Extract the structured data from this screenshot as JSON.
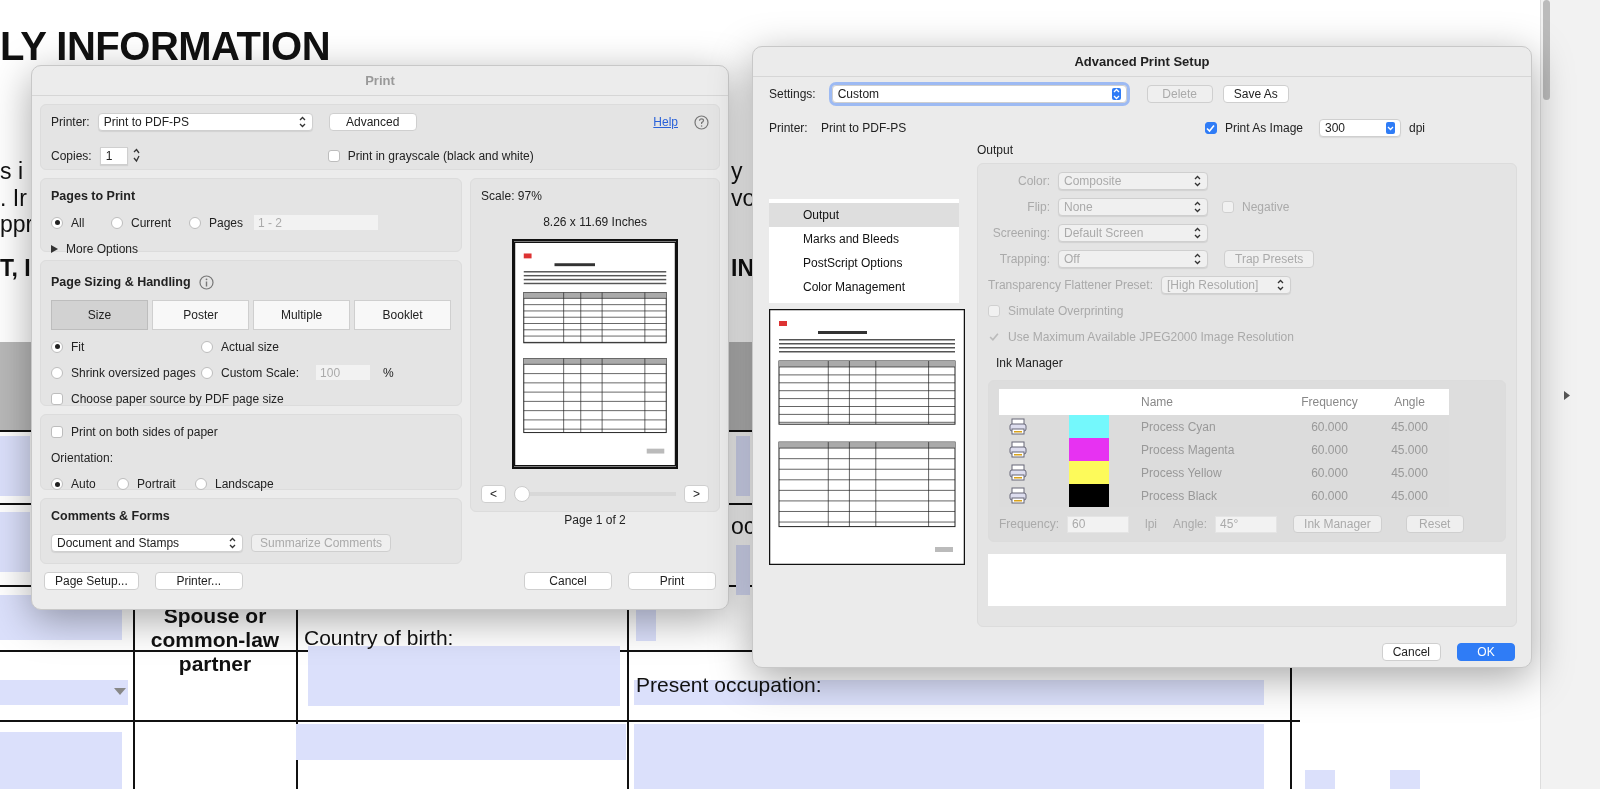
{
  "document": {
    "heading": "LY INFORMATION",
    "left_fragments": [
      {
        "text": "s i",
        "bold": false
      },
      {
        "text": ". Ir",
        "bold": false
      },
      {
        "text": "ppr",
        "bold": false
      },
      {
        "text": "T, I",
        "bold": true
      }
    ],
    "right_fragments": [
      {
        "text": "y",
        "bold": false
      },
      {
        "text": "vo",
        "bold": false
      },
      {
        "text": "IN",
        "bold": true
      },
      {
        "text": "oc",
        "bold": false
      }
    ],
    "relation": "Spouse or common-law partner",
    "country_label": "Country of birth:",
    "occupation_label": "Present occupation:"
  },
  "print_dialog": {
    "title": "Print",
    "printer_label": "Printer:",
    "printer": "Print to PDF-PS",
    "advanced_button": "Advanced",
    "help_link": "Help",
    "copies_label": "Copies:",
    "copies": "1",
    "grayscale": {
      "label": "Print in grayscale (black and white)",
      "checked": false
    },
    "pages_to_print": {
      "title": "Pages to Print",
      "options": [
        {
          "label": "All",
          "selected": true
        },
        {
          "label": "Current",
          "selected": false
        },
        {
          "label": "Pages",
          "selected": false
        }
      ],
      "range": "1 - 2",
      "more_options": "More Options"
    },
    "page_sizing": {
      "title": "Page Sizing & Handling",
      "tabs": [
        {
          "label": "Size",
          "selected": true
        },
        {
          "label": "Poster",
          "selected": false
        },
        {
          "label": "Multiple",
          "selected": false
        },
        {
          "label": "Booklet",
          "selected": false
        }
      ],
      "options": [
        {
          "label": "Fit",
          "selected": true
        },
        {
          "label": "Actual size",
          "selected": false
        },
        {
          "label": "Shrink oversized pages",
          "selected": false
        },
        {
          "label": "Custom Scale:",
          "selected": false
        }
      ],
      "custom_scale": "100",
      "percent": "%",
      "paper_source": {
        "label": "Choose paper source by PDF page size",
        "checked": false
      }
    },
    "duplex": {
      "label": "Print on both sides of paper",
      "checked": false
    },
    "orientation_label": "Orientation:",
    "orientation": [
      {
        "label": "Auto",
        "selected": true
      },
      {
        "label": "Portrait",
        "selected": false
      },
      {
        "label": "Landscape",
        "selected": false
      }
    ],
    "comments": {
      "title": "Comments & Forms",
      "select": "Document and Stamps",
      "summarize": {
        "label": "Summarize Comments",
        "disabled": true
      }
    },
    "preview": {
      "scale": "Scale:  97%",
      "size": "8.26 x 11.69 Inches",
      "prev": "<",
      "next": ">",
      "slider": {
        "level": 0
      },
      "page": "Page 1 of 2"
    },
    "left_buttons": [
      "Page Setup...",
      "Printer..."
    ],
    "right_buttons": [
      "Cancel",
      "Print"
    ]
  },
  "advanced_dialog": {
    "title": "Advanced Print Setup",
    "settings_label": "Settings:",
    "settings": "Custom",
    "delete": {
      "label": "Delete",
      "disabled": true
    },
    "save_as": {
      "label": "Save As",
      "disabled": false
    },
    "printer_label": "Printer:",
    "printer": "Print to PDF-PS",
    "print_as_image": {
      "label": "Print As Image",
      "checked": true
    },
    "dpi": "300",
    "dpi_unit": "dpi",
    "sections": [
      {
        "label": "Output",
        "selected": true
      },
      {
        "label": "Marks and Bleeds",
        "selected": false
      },
      {
        "label": "PostScript Options",
        "selected": false
      },
      {
        "label": "Color Management",
        "selected": false
      }
    ],
    "output": {
      "title": "Output",
      "disabled": true,
      "rows": [
        {
          "label": "Color:",
          "value": "Composite"
        },
        {
          "label": "Flip:",
          "value": "None",
          "checkbox": {
            "label": "Negative",
            "checked": false
          }
        },
        {
          "label": "Screening:",
          "value": "Default Screen"
        },
        {
          "label": "Trapping:",
          "value": "Off",
          "button": "Trap Presets"
        }
      ],
      "transparency": {
        "label": "Transparency Flattener Preset:",
        "value": "[High Resolution]"
      },
      "simulate": {
        "label": "Simulate Overprinting",
        "checked": false
      },
      "use_max": {
        "label": "Use Maximum Available JPEG2000 Image Resolution",
        "checked": true
      },
      "ink_title": "Ink Manager",
      "columns": [
        "Name",
        "Frequency",
        "Angle"
      ],
      "inks": [
        {
          "name": "Process Cyan",
          "color": "#74f8fc",
          "frequency": "60.000",
          "angle": "45.000"
        },
        {
          "name": "Process Magenta",
          "color": "#e732f2",
          "frequency": "60.000",
          "angle": "45.000"
        },
        {
          "name": "Process Yellow",
          "color": "#fdfa5a",
          "frequency": "60.000",
          "angle": "45.000"
        },
        {
          "name": "Process Black",
          "color": "#000000",
          "frequency": "60.000",
          "angle": "45.000"
        }
      ],
      "frequency_label": "Frequency:",
      "frequency": "60",
      "lpi": "lpi",
      "angle_label": "Angle:",
      "angle": "45°",
      "ink_button": "Ink Manager",
      "reset_button": "Reset"
    },
    "buttons": [
      {
        "label": "Cancel",
        "primary": false
      },
      {
        "label": "OK",
        "primary": true
      }
    ]
  }
}
